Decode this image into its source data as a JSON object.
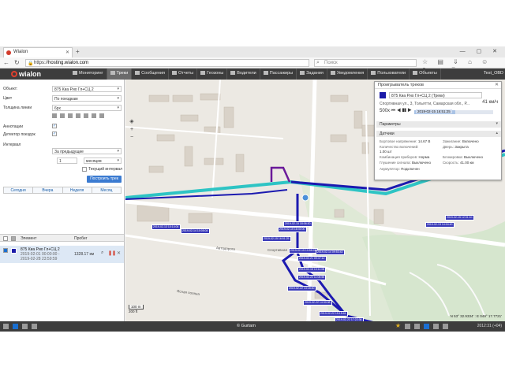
{
  "browser": {
    "tab_title": "Wialon",
    "url_host": "hosting.wialon.com",
    "url_prefix": "https://",
    "search_placeholder": "Поиск",
    "new_tab": "+"
  },
  "app": {
    "logo": "wialon",
    "menu": [
      {
        "label": "Мониторинг",
        "active": false
      },
      {
        "label": "Треки",
        "active": true
      },
      {
        "label": "Сообщения",
        "active": false
      },
      {
        "label": "Отчеты",
        "active": false
      },
      {
        "label": "Геозоны",
        "active": false
      },
      {
        "label": "Водители",
        "active": false
      },
      {
        "label": "Пассажиры",
        "active": false
      },
      {
        "label": "Задания",
        "active": false
      },
      {
        "label": "Уведомления",
        "active": false
      },
      {
        "label": "Пользователи",
        "active": false
      },
      {
        "label": "Объекты",
        "active": false
      }
    ],
    "user": "Test_OBD"
  },
  "form": {
    "object_label": "Объект:",
    "object_value": "875 Киа Рио Гл+СЦ 2",
    "color_label": "Цвет",
    "color_value": "По поездкам",
    "width_label": "Толщина линии",
    "width_value": "6px",
    "annotations_label": "Аннотации",
    "trip_detector_label": "Детектор поездок",
    "interval_label": "Интервал",
    "interval_value": "За предыдущие",
    "count_value": "1",
    "unit_value": "месяцев",
    "current_interval_label": "Текущий интервал",
    "build_button": "Построить трек",
    "periods": [
      "Сегодня",
      "Вчера",
      "Неделя",
      "Месяц"
    ]
  },
  "table": {
    "col_element": "Элемент",
    "col_mileage": "Пробег",
    "rows": [
      {
        "name": "875 Киа Рио Гл+СЦ 2",
        "from": "2019-02-01 00:00:00 -",
        "to": "2019-02-28 23:59:59",
        "mileage": "1328.17 км",
        "color": "#1a1aa8"
      }
    ]
  },
  "track_player": {
    "title": "Проигрыватель треков",
    "track_select": "875 Киа Рио Гл+СЦ 2 (Треки)",
    "address": "Спортивная ул., 3, Тольятти, Самарская обл., Р...",
    "speed": "41 км/ч",
    "speed_multiplier": "500x",
    "time": "2019-02-15 16:51:25",
    "progress": 0.52,
    "sec_params": "Параметры",
    "sec_sensors": "Датчики",
    "sensors": [
      {
        "k": "Бортовое напряжение:",
        "v": "14.67 В"
      },
      {
        "k": "Зажигание:",
        "v": "Включено"
      },
      {
        "k": "Количество включений:",
        "v": "1.00 шт"
      },
      {
        "k": "Дверь:",
        "v": "Закрыта"
      },
      {
        "k": "Комбинация приборов:",
        "v": "Норма"
      },
      {
        "k": "Блокировка:",
        "v": "Выключено"
      },
      {
        "k": "Глушение сигнала:",
        "v": "Выключено"
      },
      {
        "k": "Скорость:",
        "v": "41.00 км"
      },
      {
        "k": "Акумулятор:",
        "v": "Подключен"
      }
    ]
  },
  "map": {
    "scale_m": "100 m",
    "scale_ft": "200 ft",
    "coords": "N 53° 32.9334' : E 049° 17.7721'",
    "road_labels": [
      "Автодорога",
      "Спортивная",
      "Ясная поляна"
    ],
    "track_color": "#1c1ab0",
    "trip_color": "#2ec4c4"
  },
  "bottom": {
    "copyright": "© Gurtam",
    "datetime": "2012:31 (+04)"
  }
}
